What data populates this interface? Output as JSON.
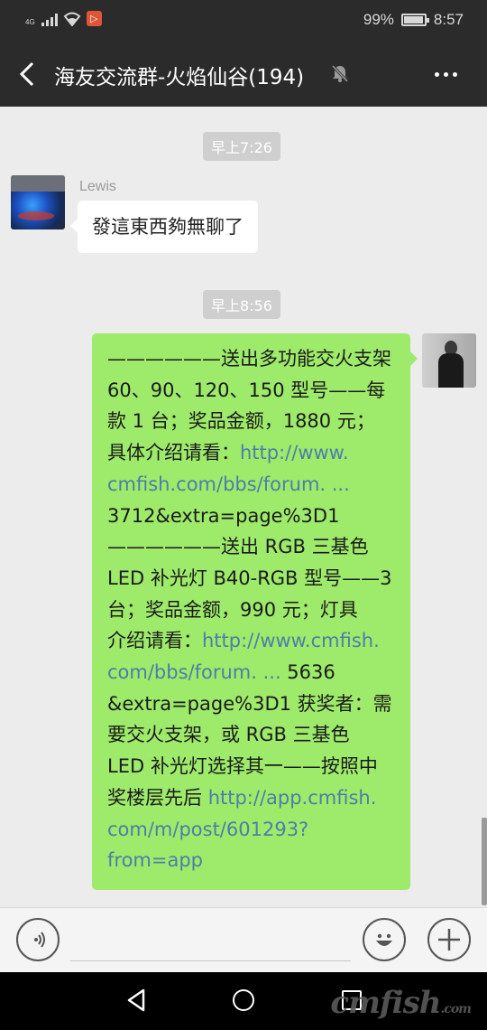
{
  "status_bar": {
    "network": "4G",
    "app_badge": "▷",
    "battery_percent": "99%",
    "battery_level": 0.99,
    "time": "8:57"
  },
  "header": {
    "title": "海友交流群-火焰仙谷(194)",
    "icons": [
      "back-arrow-icon",
      "mute-bell-icon",
      "more-dots-icon"
    ]
  },
  "messages": [
    {
      "type": "timestamp",
      "text": "早上7:26"
    },
    {
      "type": "incoming",
      "sender": "Lewis",
      "text": "發這東西夠無聊了"
    },
    {
      "type": "timestamp",
      "text": "早上8:56"
    },
    {
      "type": "outgoing",
      "lines": [
        [
          {
            "t": "——————送出多功能交火支架"
          }
        ],
        [
          {
            "t": "60、90、120、150 型号——每"
          }
        ],
        [
          {
            "t": "款 1 台；奖品金额，1880 元；"
          }
        ],
        [
          {
            "t": "具体介绍请看："
          },
          {
            "t": "http://www.",
            "link": true
          }
        ],
        [
          {
            "t": "cmfish.com/bbs/forum. ...",
            "link": true
          }
        ],
        [
          {
            "t": "3712&extra=page%3D1"
          }
        ],
        [
          {
            "t": "——————送出 RGB 三基色"
          }
        ],
        [
          {
            "t": "LED 补光灯 B40-RGB 型号——3"
          }
        ],
        [
          {
            "t": "台；奖品金额，990 元；灯具"
          }
        ],
        [
          {
            "t": "介绍请看："
          },
          {
            "t": "http://www.cmfish.",
            "link": true
          }
        ],
        [
          {
            "t": "com/bbs/forum. ...",
            "link": true
          },
          {
            "t": " 5636"
          }
        ],
        [
          {
            "t": "&extra=page%3D1 获奖者：需"
          }
        ],
        [
          {
            "t": "要交火支架，或 RGB 三基色"
          }
        ],
        [
          {
            "t": "LED 补光灯选择其一——按照中"
          }
        ],
        [
          {
            "t": "奖楼层先后 "
          },
          {
            "t": "http://app.cmfish.",
            "link": true
          }
        ],
        [
          {
            "t": "com/m/post/601293?",
            "link": true
          }
        ],
        [
          {
            "t": "from=app",
            "link": true
          }
        ]
      ]
    }
  ],
  "input_bar": {
    "icons": [
      "voice-icon",
      "emoji-icon",
      "plus-icon"
    ]
  },
  "nav_bar": {
    "watermark": "cmfish",
    "watermark_suffix": ".com"
  },
  "colors": {
    "header_bg": "#2b2b2b",
    "chat_bg": "#ececec",
    "outgoing_bubble": "#9eea6a",
    "incoming_bubble": "#ffffff",
    "link": "#4d7ea8"
  }
}
